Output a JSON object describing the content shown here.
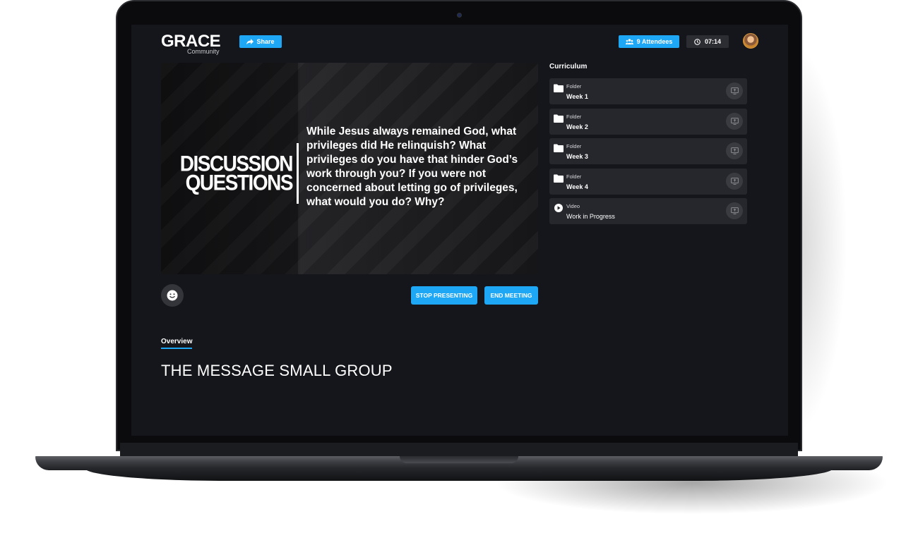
{
  "header": {
    "logo_main": "GRACE",
    "logo_sub": "Community",
    "share_label": "Share",
    "attendees_label": "9 Attendees",
    "timer": "07:14"
  },
  "slide": {
    "heading_line1": "DISCUSSION",
    "heading_line2": "QUESTIONS",
    "body": "While Jesus always remained God, what privileges did He relinquish? What privileges do you have that hinder God’s work through you? If you were not concerned about letting go of privileges, what would you do? Why?"
  },
  "controls": {
    "stop_presenting": "STOP PRESENTING",
    "end_meeting": "END MEETING"
  },
  "overview": {
    "tab_label": "Overview",
    "title": "THE MESSAGE SMALL GROUP"
  },
  "curriculum": {
    "label": "Curriculum",
    "items": [
      {
        "type": "Folder",
        "name": "Week 1"
      },
      {
        "type": "Folder",
        "name": "Week 2"
      },
      {
        "type": "Folder",
        "name": "Week 3"
      },
      {
        "type": "Folder",
        "name": "Week 4"
      },
      {
        "type": "Video",
        "name": "Work in Progress"
      }
    ]
  },
  "colors": {
    "accent": "#1ea7f5",
    "screen_bg": "#15161b",
    "card_bg": "#26272c"
  }
}
